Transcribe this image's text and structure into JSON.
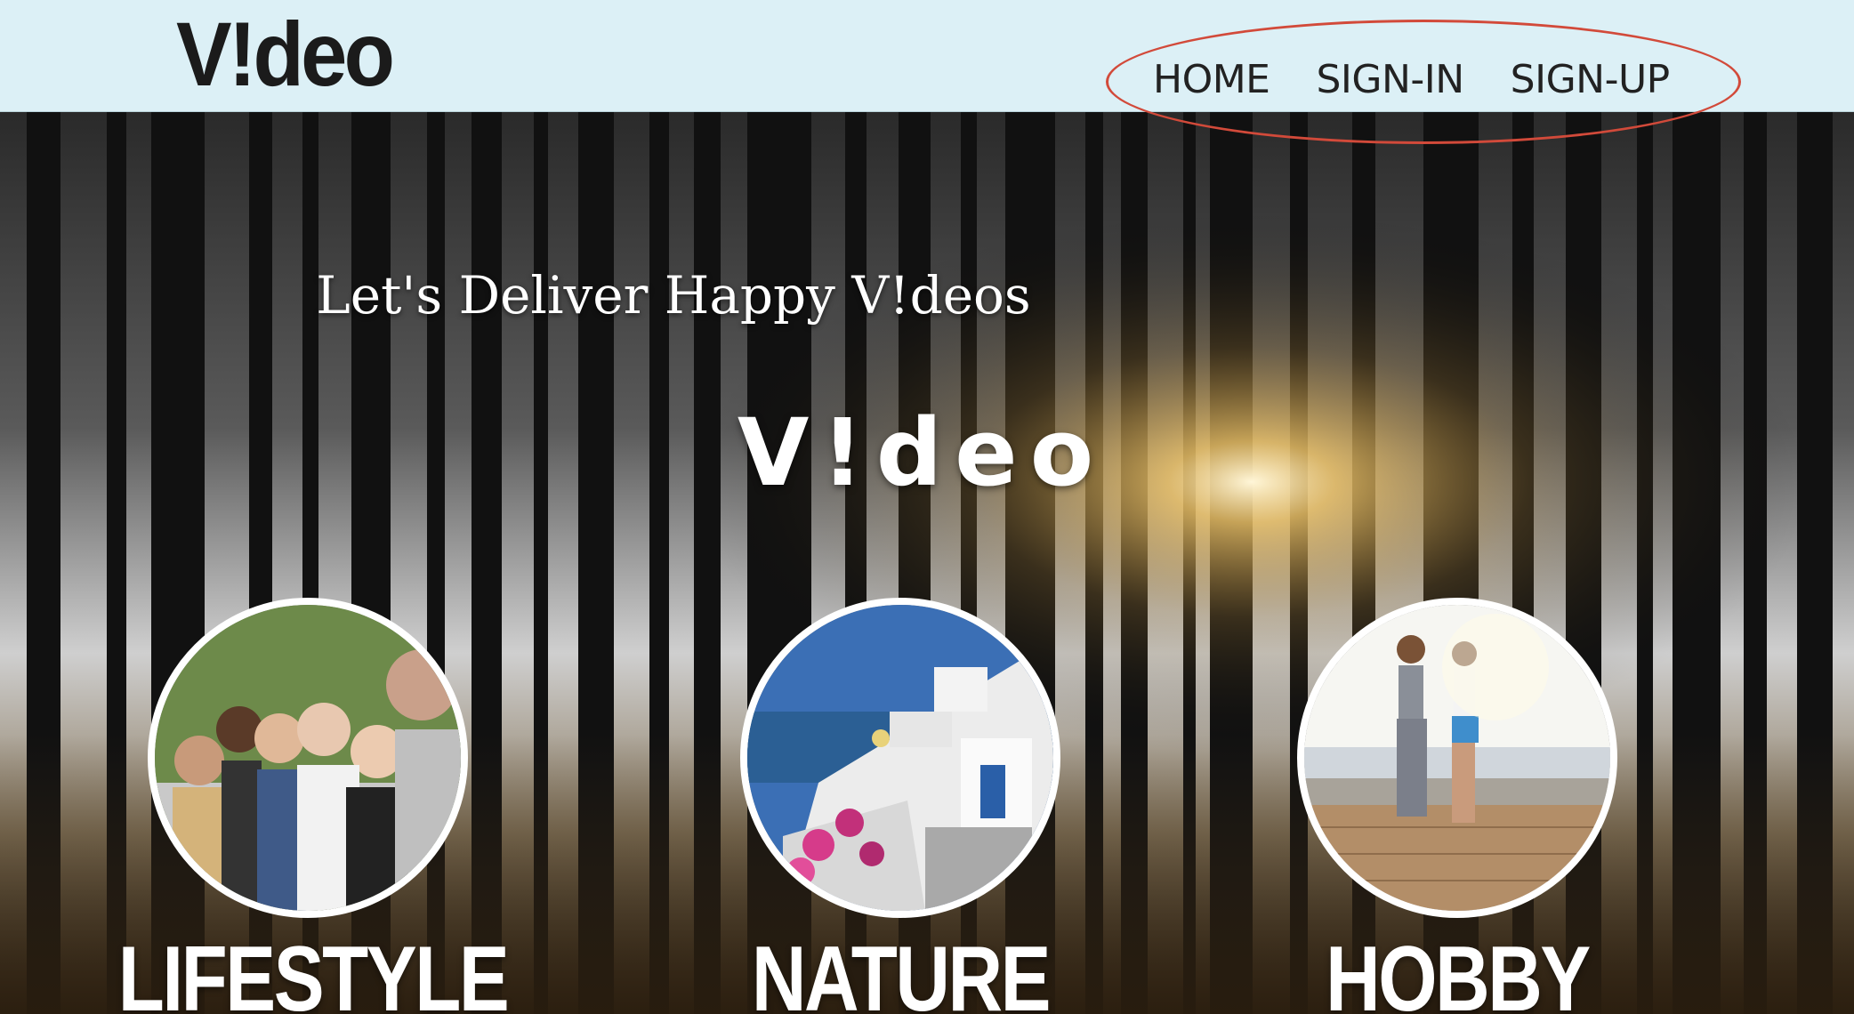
{
  "header": {
    "logo": "V!deo",
    "nav": [
      "HOME",
      "SIGN-IN",
      "SIGN-UP"
    ]
  },
  "hero": {
    "tagline": "Let's Deliver Happy V!deos",
    "logo": "V!deo",
    "background": "forest-sunlight-image"
  },
  "categories": [
    {
      "label": "LIFESTYLE",
      "image": "group-of-people-photo"
    },
    {
      "label": "NATURE",
      "image": "seaside-town-photo"
    },
    {
      "label": "HOBBY",
      "image": "runners-on-boardwalk-photo"
    }
  ],
  "colors": {
    "header_bg": "#dcf0f6",
    "nav_highlight_ring": "#d24a3a",
    "text_light": "#ffffff"
  }
}
